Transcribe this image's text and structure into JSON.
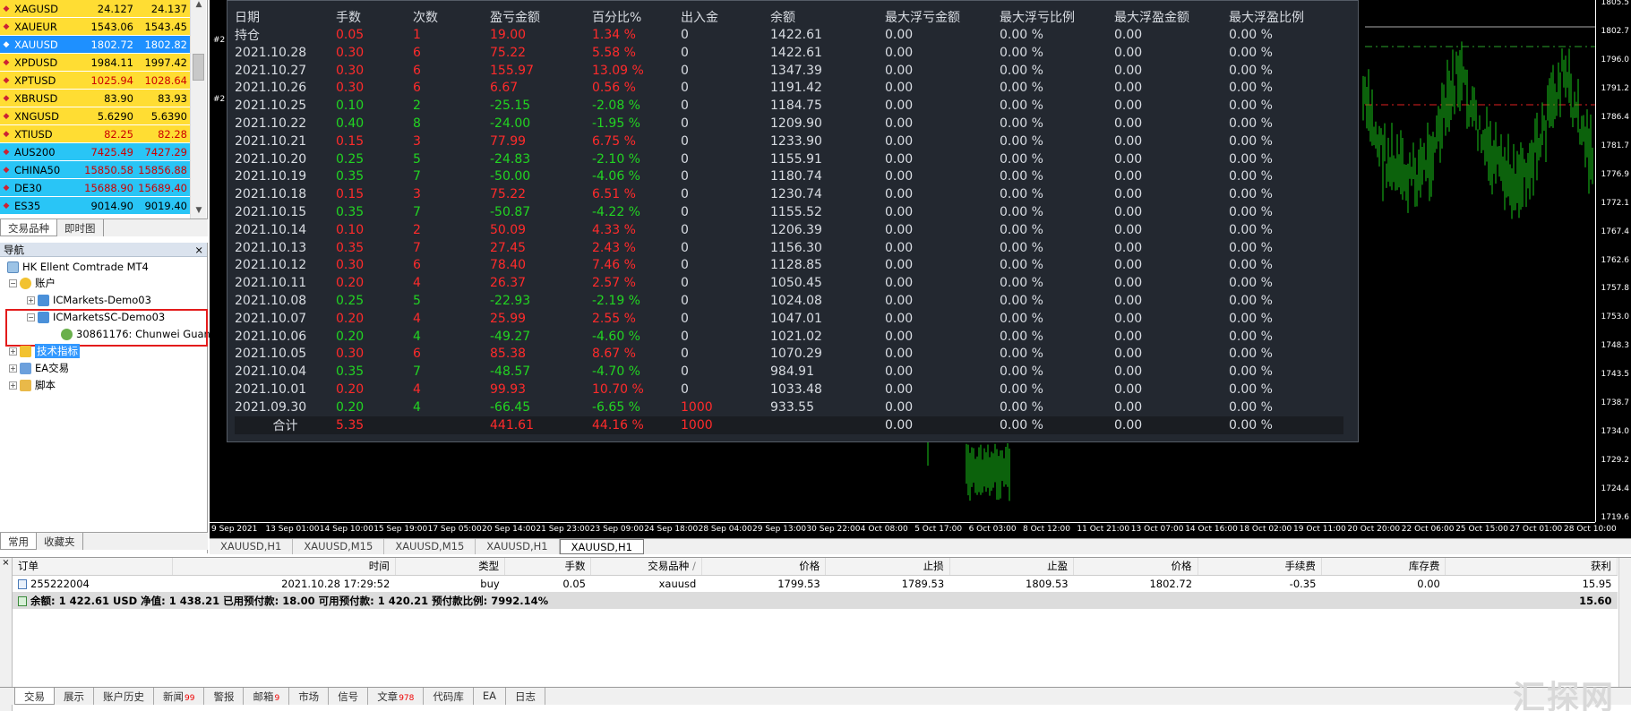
{
  "market_watch": {
    "rows": [
      {
        "symbol": "XAGUSD",
        "bid": "24.127",
        "ask": "24.137",
        "bg": "#ffdd33",
        "price_color": "#000000",
        "selected": false
      },
      {
        "symbol": "XAUEUR",
        "bid": "1543.06",
        "ask": "1543.45",
        "bg": "#ffdd33",
        "price_color": "#000000",
        "selected": false
      },
      {
        "symbol": "XAUUSD",
        "bid": "1802.72",
        "ask": "1802.82",
        "bg": "#1e90ff",
        "price_color": "#ffffff",
        "selected": true
      },
      {
        "symbol": "XPDUSD",
        "bid": "1984.11",
        "ask": "1997.42",
        "bg": "#ffdd33",
        "price_color": "#000000",
        "selected": false
      },
      {
        "symbol": "XPTUSD",
        "bid": "1025.94",
        "ask": "1028.64",
        "bg": "#ffdd33",
        "price_color": "#cc0000",
        "selected": false
      },
      {
        "symbol": "XBRUSD",
        "bid": "83.90",
        "ask": "83.93",
        "bg": "#ffdd33",
        "price_color": "#000000",
        "selected": false
      },
      {
        "symbol": "XNGUSD",
        "bid": "5.6290",
        "ask": "5.6390",
        "bg": "#ffdd33",
        "price_color": "#000000",
        "selected": false
      },
      {
        "symbol": "XTIUSD",
        "bid": "82.25",
        "ask": "82.28",
        "bg": "#ffdd33",
        "price_color": "#cc0000",
        "selected": false
      },
      {
        "symbol": "AUS200",
        "bid": "7425.49",
        "ask": "7427.29",
        "bg": "#29c5f6",
        "price_color": "#cc0000",
        "selected": false
      },
      {
        "symbol": "CHINA50",
        "bid": "15850.58",
        "ask": "15856.88",
        "bg": "#29c5f6",
        "price_color": "#cc0000",
        "selected": false
      },
      {
        "symbol": "DE30",
        "bid": "15688.90",
        "ask": "15689.40",
        "bg": "#29c5f6",
        "price_color": "#cc0000",
        "selected": false
      },
      {
        "symbol": "ES35",
        "bid": "9014.90",
        "ask": "9019.40",
        "bg": "#29c5f6",
        "price_color": "#000000",
        "selected": false
      }
    ],
    "tabs": [
      "交易品种",
      "即时图"
    ]
  },
  "navigator": {
    "title": "导航",
    "close": "×",
    "items": {
      "root": "HK Ellent Comtrade MT4",
      "accounts": "账户",
      "acct1": "ICMarkets-Demo03",
      "acct2": "ICMarketsSC-Demo03",
      "user": "30861176: Chunwei Guan",
      "indicators": "技术指标",
      "ea": "EA交易",
      "scripts": "脚本"
    },
    "tabs": [
      "常用",
      "收藏夹"
    ]
  },
  "chart": {
    "price_labels": [
      "1805.5",
      "1802.7",
      "1796.0",
      "1791.2",
      "1786.4",
      "1781.7",
      "1776.9",
      "1772.1",
      "1767.4",
      "1762.6",
      "1757.8",
      "1753.0",
      "1748.3",
      "1743.5",
      "1738.7",
      "1734.0",
      "1729.2",
      "1724.4",
      "1719.6"
    ],
    "time_labels": [
      "9 Sep 2021",
      "13 Sep 01:00",
      "14 Sep 10:00",
      "15 Sep 19:00",
      "17 Sep 05:00",
      "20 Sep 14:00",
      "21 Sep 23:00",
      "23 Sep 09:00",
      "24 Sep 18:00",
      "28 Sep 04:00",
      "29 Sep 13:00",
      "30 Sep 22:00",
      "4 Oct 08:00",
      "5 Oct 17:00",
      "6 Oct 03:00",
      "8 Oct 12:00",
      "11 Oct 21:00",
      "13 Oct 07:00",
      "14 Oct 16:00",
      "18 Oct 02:00",
      "19 Oct 11:00",
      "20 Oct 20:00",
      "22 Oct 06:00",
      "25 Oct 15:00",
      "27 Oct 01:00",
      "28 Oct 10:00"
    ],
    "side_marks": [
      "#2",
      "#2"
    ]
  },
  "stats": {
    "headers": [
      "日期",
      "手数",
      "次数",
      "盈亏金额",
      "百分比%",
      "出入金",
      "余额",
      "最大浮亏金额",
      "最大浮亏比例",
      "最大浮盈金额",
      "最大浮盈比例"
    ],
    "rows": [
      {
        "date": "持仓",
        "lots": "0.05",
        "count": "1",
        "pnl": "19.00",
        "pct": "1.34 %",
        "dep": "0",
        "bal": "1422.61",
        "maxloss": "0.00",
        "maxlosspct": "0.00 %",
        "maxprofit": "0.00",
        "maxprofitpct": "0.00 %",
        "color": "red"
      },
      {
        "date": "2021.10.28",
        "lots": "0.30",
        "count": "6",
        "pnl": "75.22",
        "pct": "5.58 %",
        "dep": "0",
        "bal": "1422.61",
        "maxloss": "0.00",
        "maxlosspct": "0.00 %",
        "maxprofit": "0.00",
        "maxprofitpct": "0.00 %",
        "color": "red"
      },
      {
        "date": "2021.10.27",
        "lots": "0.30",
        "count": "6",
        "pnl": "155.97",
        "pct": "13.09 %",
        "dep": "0",
        "bal": "1347.39",
        "maxloss": "0.00",
        "maxlosspct": "0.00 %",
        "maxprofit": "0.00",
        "maxprofitpct": "0.00 %",
        "color": "red"
      },
      {
        "date": "2021.10.26",
        "lots": "0.30",
        "count": "6",
        "pnl": "6.67",
        "pct": "0.56 %",
        "dep": "0",
        "bal": "1191.42",
        "maxloss": "0.00",
        "maxlosspct": "0.00 %",
        "maxprofit": "0.00",
        "maxprofitpct": "0.00 %",
        "color": "red"
      },
      {
        "date": "2021.10.25",
        "lots": "0.10",
        "count": "2",
        "pnl": "-25.15",
        "pct": "-2.08 %",
        "dep": "0",
        "bal": "1184.75",
        "maxloss": "0.00",
        "maxlosspct": "0.00 %",
        "maxprofit": "0.00",
        "maxprofitpct": "0.00 %",
        "color": "green"
      },
      {
        "date": "2021.10.22",
        "lots": "0.40",
        "count": "8",
        "pnl": "-24.00",
        "pct": "-1.95 %",
        "dep": "0",
        "bal": "1209.90",
        "maxloss": "0.00",
        "maxlosspct": "0.00 %",
        "maxprofit": "0.00",
        "maxprofitpct": "0.00 %",
        "color": "green"
      },
      {
        "date": "2021.10.21",
        "lots": "0.15",
        "count": "3",
        "pnl": "77.99",
        "pct": "6.75 %",
        "dep": "0",
        "bal": "1233.90",
        "maxloss": "0.00",
        "maxlosspct": "0.00 %",
        "maxprofit": "0.00",
        "maxprofitpct": "0.00 %",
        "color": "red"
      },
      {
        "date": "2021.10.20",
        "lots": "0.25",
        "count": "5",
        "pnl": "-24.83",
        "pct": "-2.10 %",
        "dep": "0",
        "bal": "1155.91",
        "maxloss": "0.00",
        "maxlosspct": "0.00 %",
        "maxprofit": "0.00",
        "maxprofitpct": "0.00 %",
        "color": "green"
      },
      {
        "date": "2021.10.19",
        "lots": "0.35",
        "count": "7",
        "pnl": "-50.00",
        "pct": "-4.06 %",
        "dep": "0",
        "bal": "1180.74",
        "maxloss": "0.00",
        "maxlosspct": "0.00 %",
        "maxprofit": "0.00",
        "maxprofitpct": "0.00 %",
        "color": "green"
      },
      {
        "date": "2021.10.18",
        "lots": "0.15",
        "count": "3",
        "pnl": "75.22",
        "pct": "6.51 %",
        "dep": "0",
        "bal": "1230.74",
        "maxloss": "0.00",
        "maxlosspct": "0.00 %",
        "maxprofit": "0.00",
        "maxprofitpct": "0.00 %",
        "color": "red"
      },
      {
        "date": "2021.10.15",
        "lots": "0.35",
        "count": "7",
        "pnl": "-50.87",
        "pct": "-4.22 %",
        "dep": "0",
        "bal": "1155.52",
        "maxloss": "0.00",
        "maxlosspct": "0.00 %",
        "maxprofit": "0.00",
        "maxprofitpct": "0.00 %",
        "color": "green"
      },
      {
        "date": "2021.10.14",
        "lots": "0.10",
        "count": "2",
        "pnl": "50.09",
        "pct": "4.33 %",
        "dep": "0",
        "bal": "1206.39",
        "maxloss": "0.00",
        "maxlosspct": "0.00 %",
        "maxprofit": "0.00",
        "maxprofitpct": "0.00 %",
        "color": "red"
      },
      {
        "date": "2021.10.13",
        "lots": "0.35",
        "count": "7",
        "pnl": "27.45",
        "pct": "2.43 %",
        "dep": "0",
        "bal": "1156.30",
        "maxloss": "0.00",
        "maxlosspct": "0.00 %",
        "maxprofit": "0.00",
        "maxprofitpct": "0.00 %",
        "color": "red"
      },
      {
        "date": "2021.10.12",
        "lots": "0.30",
        "count": "6",
        "pnl": "78.40",
        "pct": "7.46 %",
        "dep": "0",
        "bal": "1128.85",
        "maxloss": "0.00",
        "maxlosspct": "0.00 %",
        "maxprofit": "0.00",
        "maxprofitpct": "0.00 %",
        "color": "red"
      },
      {
        "date": "2021.10.11",
        "lots": "0.20",
        "count": "4",
        "pnl": "26.37",
        "pct": "2.57 %",
        "dep": "0",
        "bal": "1050.45",
        "maxloss": "0.00",
        "maxlosspct": "0.00 %",
        "maxprofit": "0.00",
        "maxprofitpct": "0.00 %",
        "color": "red"
      },
      {
        "date": "2021.10.08",
        "lots": "0.25",
        "count": "5",
        "pnl": "-22.93",
        "pct": "-2.19 %",
        "dep": "0",
        "bal": "1024.08",
        "maxloss": "0.00",
        "maxlosspct": "0.00 %",
        "maxprofit": "0.00",
        "maxprofitpct": "0.00 %",
        "color": "green"
      },
      {
        "date": "2021.10.07",
        "lots": "0.20",
        "count": "4",
        "pnl": "25.99",
        "pct": "2.55 %",
        "dep": "0",
        "bal": "1047.01",
        "maxloss": "0.00",
        "maxlosspct": "0.00 %",
        "maxprofit": "0.00",
        "maxprofitpct": "0.00 %",
        "color": "red"
      },
      {
        "date": "2021.10.06",
        "lots": "0.20",
        "count": "4",
        "pnl": "-49.27",
        "pct": "-4.60 %",
        "dep": "0",
        "bal": "1021.02",
        "maxloss": "0.00",
        "maxlosspct": "0.00 %",
        "maxprofit": "0.00",
        "maxprofitpct": "0.00 %",
        "color": "green"
      },
      {
        "date": "2021.10.05",
        "lots": "0.30",
        "count": "6",
        "pnl": "85.38",
        "pct": "8.67 %",
        "dep": "0",
        "bal": "1070.29",
        "maxloss": "0.00",
        "maxlosspct": "0.00 %",
        "maxprofit": "0.00",
        "maxprofitpct": "0.00 %",
        "color": "red"
      },
      {
        "date": "2021.10.04",
        "lots": "0.35",
        "count": "7",
        "pnl": "-48.57",
        "pct": "-4.70 %",
        "dep": "0",
        "bal": "984.91",
        "maxloss": "0.00",
        "maxlosspct": "0.00 %",
        "maxprofit": "0.00",
        "maxprofitpct": "0.00 %",
        "color": "green"
      },
      {
        "date": "2021.10.01",
        "lots": "0.20",
        "count": "4",
        "pnl": "99.93",
        "pct": "10.70 %",
        "dep": "0",
        "bal": "1033.48",
        "maxloss": "0.00",
        "maxlosspct": "0.00 %",
        "maxprofit": "0.00",
        "maxprofitpct": "0.00 %",
        "color": "red"
      },
      {
        "date": "2021.09.30",
        "lots": "0.20",
        "count": "4",
        "pnl": "-66.45",
        "pct": "-6.65 %",
        "dep": "1000",
        "bal": "933.55",
        "maxloss": "0.00",
        "maxlosspct": "0.00 %",
        "maxprofit": "0.00",
        "maxprofitpct": "0.00 %",
        "color": "green"
      }
    ],
    "total": {
      "label": "合计",
      "lots": "5.35",
      "pnl": "441.61",
      "pct": "44.16 %",
      "dep": "1000",
      "maxloss": "0.00",
      "maxlosspct": "0.00 %",
      "maxprofit": "0.00",
      "maxprofitpct": "0.00 %"
    }
  },
  "chart_tabs": [
    "XAUUSD,H1",
    "XAUUSD,M15",
    "XAUUSD,M15",
    "XAUUSD,H1",
    "XAUUSD,H1"
  ],
  "terminal": {
    "headers": [
      "订单",
      "时间",
      "类型",
      "手数",
      "交易品种",
      "价格",
      "止损",
      "止盈",
      "价格",
      "手续费",
      "库存费",
      "获利"
    ],
    "sort_mark": "/",
    "order": {
      "id": "255222004",
      "time": "2021.10.28 17:29:52",
      "type": "buy",
      "lots": "0.05",
      "symbol": "xauusd",
      "open": "1799.53",
      "sl": "1789.53",
      "tp": "1809.53",
      "price": "1802.72",
      "commission": "-0.35",
      "swap": "0.00",
      "profit": "15.95"
    },
    "balance_line": "余额: 1 422.61 USD  净值: 1 438.21  已用预付款: 18.00  可用预付款: 1 420.21  预付款比例: 7992.14%",
    "balance_profit": "15.60",
    "tabs": [
      {
        "label": "交易",
        "badge": ""
      },
      {
        "label": "展示",
        "badge": ""
      },
      {
        "label": "账户历史",
        "badge": ""
      },
      {
        "label": "新闻",
        "badge": "99"
      },
      {
        "label": "警报",
        "badge": ""
      },
      {
        "label": "邮箱",
        "badge": "9"
      },
      {
        "label": "市场",
        "badge": ""
      },
      {
        "label": "信号",
        "badge": ""
      },
      {
        "label": "文章",
        "badge": "978"
      },
      {
        "label": "代码库",
        "badge": ""
      },
      {
        "label": "EA",
        "badge": ""
      },
      {
        "label": "日志",
        "badge": ""
      }
    ]
  },
  "watermark": "汇探网"
}
